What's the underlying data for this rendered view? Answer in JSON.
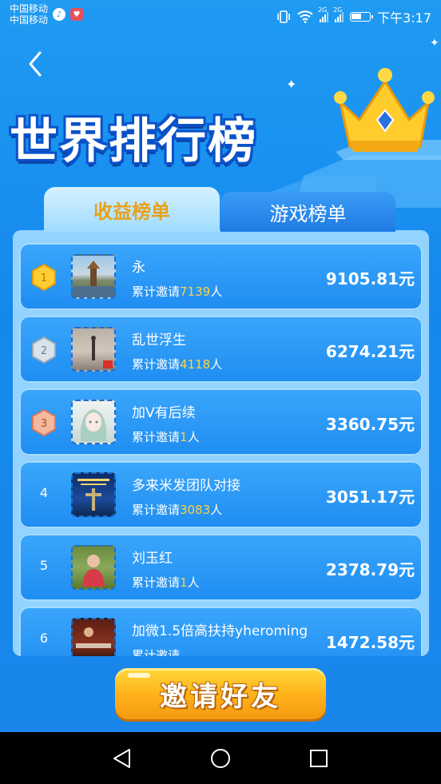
{
  "status_bar": {
    "carrier_1": "中国移动",
    "carrier_2": "中国移动",
    "network_1": "2G",
    "network_2": "2G",
    "time": "下午3:17"
  },
  "header": {
    "title": "世界排行榜"
  },
  "tabs": [
    {
      "label": "收益榜单",
      "active": true
    },
    {
      "label": "游戏榜单",
      "active": false
    }
  ],
  "rankings": [
    {
      "rank": "1",
      "name": "永",
      "invite_prefix": "累计邀请",
      "invite_count": "7139",
      "invite_suffix": "人",
      "amount": "9105.81元"
    },
    {
      "rank": "2",
      "name": "乱世浮生",
      "invite_prefix": "累计邀请",
      "invite_count": "4118",
      "invite_suffix": "人",
      "amount": "6274.21元"
    },
    {
      "rank": "3",
      "name": "加V有后续",
      "invite_prefix": "累计邀请",
      "invite_count": "1",
      "invite_suffix": "人",
      "amount": "3360.75元"
    },
    {
      "rank": "4",
      "name": "多来米发团队对接",
      "invite_prefix": "累计邀请",
      "invite_count": "3083",
      "invite_suffix": "人",
      "amount": "3051.17元"
    },
    {
      "rank": "5",
      "name": "刘玉红",
      "invite_prefix": "累计邀请",
      "invite_count": "1",
      "invite_suffix": "人",
      "amount": "2378.79元"
    },
    {
      "rank": "6",
      "name": "加微1.5倍高扶持yheroming",
      "invite_prefix": "累计邀请",
      "invite_count": "",
      "invite_suffix": "",
      "amount": "1472.58元"
    }
  ],
  "invite_button": {
    "label": "邀请好友"
  },
  "colors": {
    "background": "#1a8ff0",
    "gold": "#ffd23c",
    "button": "#ffb019"
  }
}
